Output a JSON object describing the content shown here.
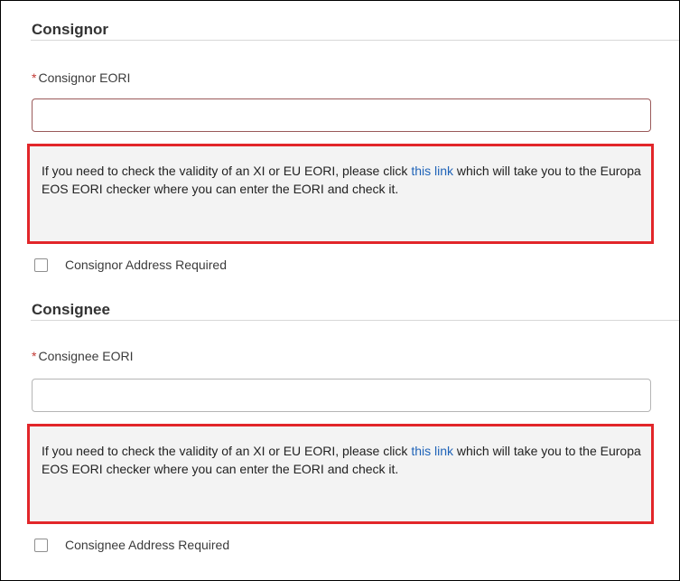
{
  "consignor": {
    "title": "Consignor",
    "eori_label": "Consignor EORI",
    "required_marker": "*",
    "eori_value": "",
    "info": {
      "text_before": "If you need to check the validity of an XI or EU EORI, please click ",
      "link_text": "this link",
      "text_after": " which will take you to the Europa EOS EORI checker where you can enter the EORI and check it."
    },
    "address_checkbox_label": "Consignor Address Required"
  },
  "consignee": {
    "title": "Consignee",
    "eori_label": "Consignee EORI",
    "required_marker": "*",
    "eori_value": "",
    "info": {
      "text_before": "If you need to check the validity of an XI or EU EORI, please click ",
      "link_text": "this link",
      "text_after": " which will take you to the Europa EOS EORI checker where you can enter the EORI and check it."
    },
    "address_checkbox_label": "Consignee Address Required"
  },
  "colors": {
    "required": "#c23934",
    "link": "#1f63b8",
    "highlight_border": "#e2262a",
    "info_background": "#f3f3f3"
  }
}
